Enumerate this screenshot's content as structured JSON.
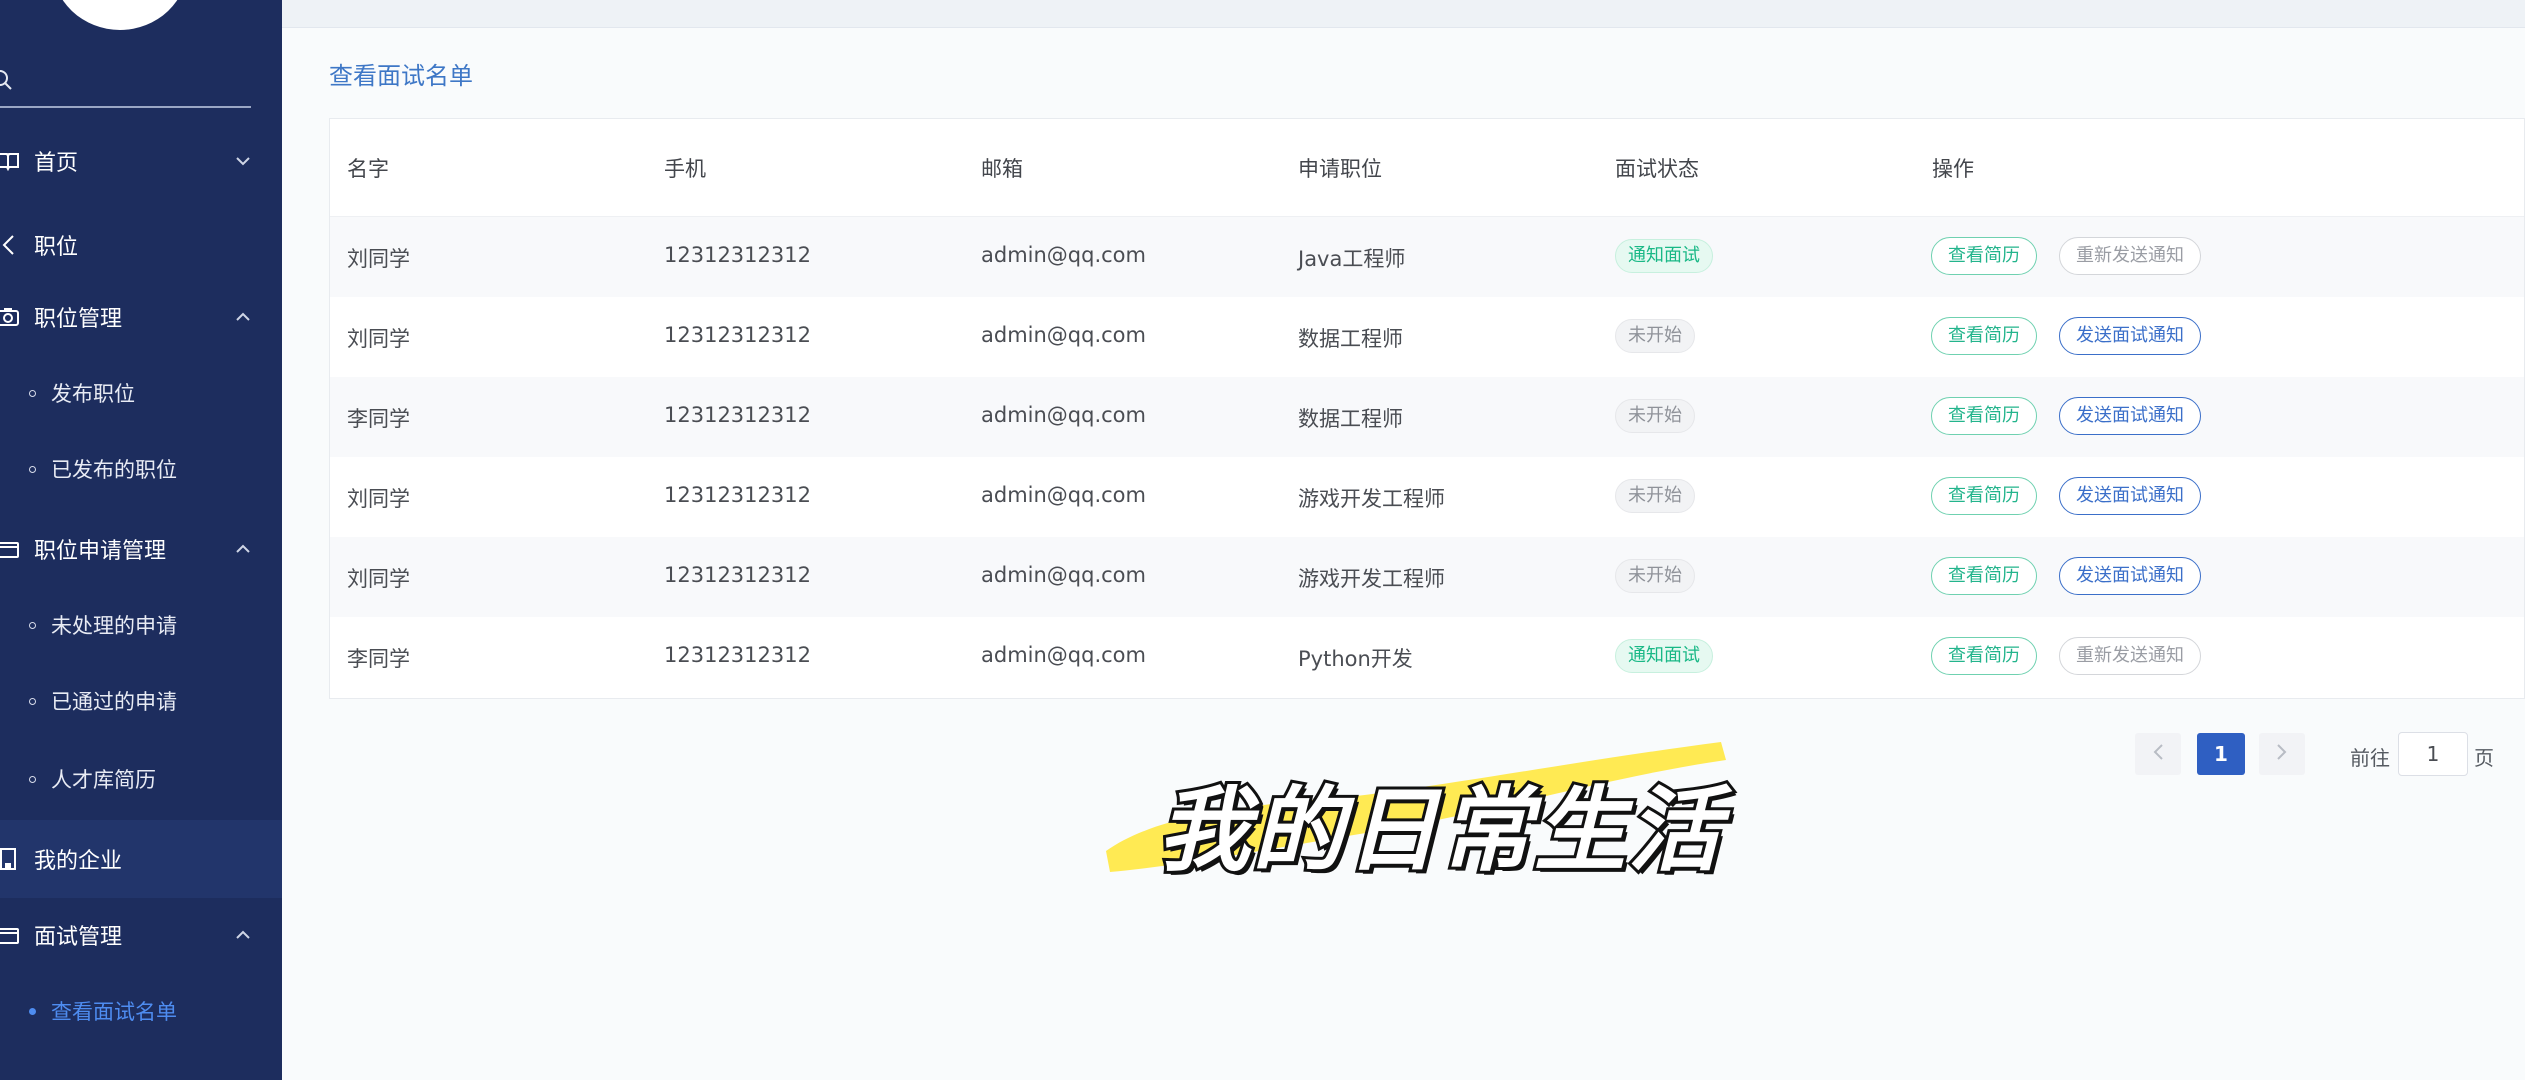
{
  "sidebar": {
    "search": {
      "placeholder": "",
      "value": ""
    },
    "items": [
      {
        "label": "首页"
      },
      {
        "label": "职位"
      },
      {
        "label": "职位管理"
      },
      {
        "label": "发布职位"
      },
      {
        "label": "已发布的职位"
      },
      {
        "label": "职位申请管理"
      },
      {
        "label": "未处理的申请"
      },
      {
        "label": "已通过的申请"
      },
      {
        "label": "人才库简历"
      },
      {
        "label": "我的企业"
      },
      {
        "label": "面试管理"
      },
      {
        "label": "查看面试名单"
      }
    ]
  },
  "main": {
    "title": "查看面试名单",
    "table": {
      "headers": [
        "名字",
        "手机",
        "邮箱",
        "申请职位",
        "面试状态",
        "操作"
      ],
      "rows": [
        {
          "name": "刘同学",
          "phone": "12312312312",
          "email": "admin@qq.com",
          "position": "Java工程师",
          "status": "通知面试",
          "action1": "查看简历",
          "action2": "重新发送通知"
        },
        {
          "name": "刘同学",
          "phone": "12312312312",
          "email": "admin@qq.com",
          "position": "数据工程师",
          "status": "未开始",
          "action1": "查看简历",
          "action2": "发送面试通知"
        },
        {
          "name": "李同学",
          "phone": "12312312312",
          "email": "admin@qq.com",
          "position": "数据工程师",
          "status": "未开始",
          "action1": "查看简历",
          "action2": "发送面试通知"
        },
        {
          "name": "刘同学",
          "phone": "12312312312",
          "email": "admin@qq.com",
          "position": "游戏开发工程师",
          "status": "未开始",
          "action1": "查看简历",
          "action2": "发送面试通知"
        },
        {
          "name": "刘同学",
          "phone": "12312312312",
          "email": "admin@qq.com",
          "position": "游戏开发工程师",
          "status": "未开始",
          "action1": "查看简历",
          "action2": "发送面试通知"
        },
        {
          "name": "李同学",
          "phone": "12312312312",
          "email": "admin@qq.com",
          "position": "Python开发",
          "status": "通知面试",
          "action1": "查看简历",
          "action2": "重新发送通知"
        }
      ]
    },
    "pagination": {
      "current": "1",
      "goto_label": "前往",
      "goto_value": "1",
      "page_suffix": "页"
    }
  },
  "overlay": {
    "caption": "我的日常生活"
  },
  "colors": {
    "sidebar_bg": "#1d2d5e",
    "accent_blue": "#3e77c6",
    "success_green": "#19b886",
    "page_active": "#2f5fc2",
    "caption_highlight": "#ffe94a"
  }
}
